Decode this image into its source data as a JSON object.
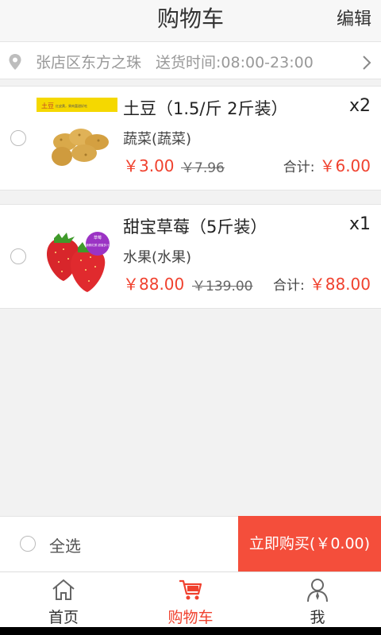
{
  "header": {
    "title": "购物车",
    "edit_label": "编辑"
  },
  "address": {
    "location": "张店区东方之珠",
    "delivery_time": "送货时间:08:00-23:00",
    "icon": "location-pin-icon"
  },
  "items": [
    {
      "name": "土豆（1.5/斤 2斤装）",
      "quantity": "x2",
      "category": "蔬菜(蔬菜)",
      "price": "￥3.00",
      "original_price": "￥7.96",
      "total_label": "合计:",
      "total": "￥6.00",
      "banner_text": "土豆",
      "banner_sub": "红皮黄，果肉富甜好吃"
    },
    {
      "name": "甜宝草莓（5斤装）",
      "quantity": "x1",
      "category": "水果(水果)",
      "price": "￥88.00",
      "original_price": "￥139.00",
      "total_label": "合计:",
      "total": "￥88.00",
      "badge_text": "草莓",
      "badge_sub": "新鲜红颜 甜蜜多汁"
    }
  ],
  "bottom_bar": {
    "select_all_label": "全选",
    "buy_label": "立即购买(￥0.00)"
  },
  "tabs": [
    {
      "label": "首页",
      "icon": "home-icon",
      "active": false
    },
    {
      "label": "购物车",
      "icon": "cart-icon",
      "active": true
    },
    {
      "label": "我",
      "icon": "user-icon",
      "active": false
    }
  ],
  "colors": {
    "accent": "#f0412e",
    "buy_button": "#f44e3b"
  }
}
